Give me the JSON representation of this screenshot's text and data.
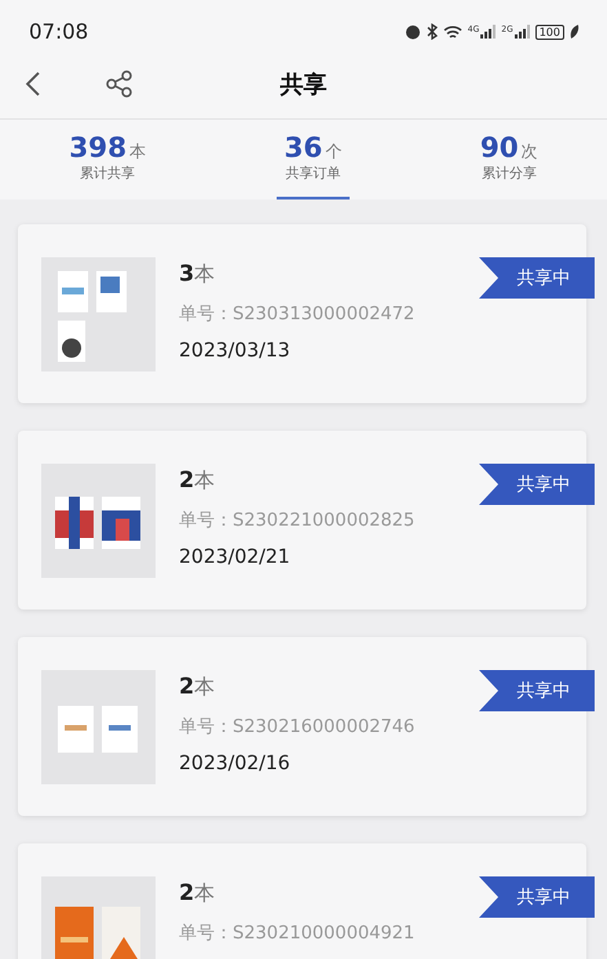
{
  "status_bar": {
    "time": "07:08",
    "signals": [
      {
        "label": "4G"
      },
      {
        "label": "2G"
      }
    ],
    "battery": "100"
  },
  "header": {
    "title": "共享"
  },
  "stats": [
    {
      "value": "398",
      "unit": "本",
      "label": "累计共享",
      "selected": false
    },
    {
      "value": "36",
      "unit": "个",
      "label": "共享订单",
      "selected": true
    },
    {
      "value": "90",
      "unit": "次",
      "label": "累计分享",
      "selected": false
    }
  ],
  "orders": [
    {
      "count": "3",
      "unit": "本",
      "order_no": "单号：S230313000002472",
      "date": "2023/03/13",
      "status": "共享中"
    },
    {
      "count": "2",
      "unit": "本",
      "order_no": "单号：S230221000002825",
      "date": "2023/02/21",
      "status": "共享中"
    },
    {
      "count": "2",
      "unit": "本",
      "order_no": "单号：S230216000002746",
      "date": "2023/02/16",
      "status": "共享中"
    },
    {
      "count": "2",
      "unit": "本",
      "order_no": "单号：S230210000004921",
      "status": "共享中"
    }
  ]
}
